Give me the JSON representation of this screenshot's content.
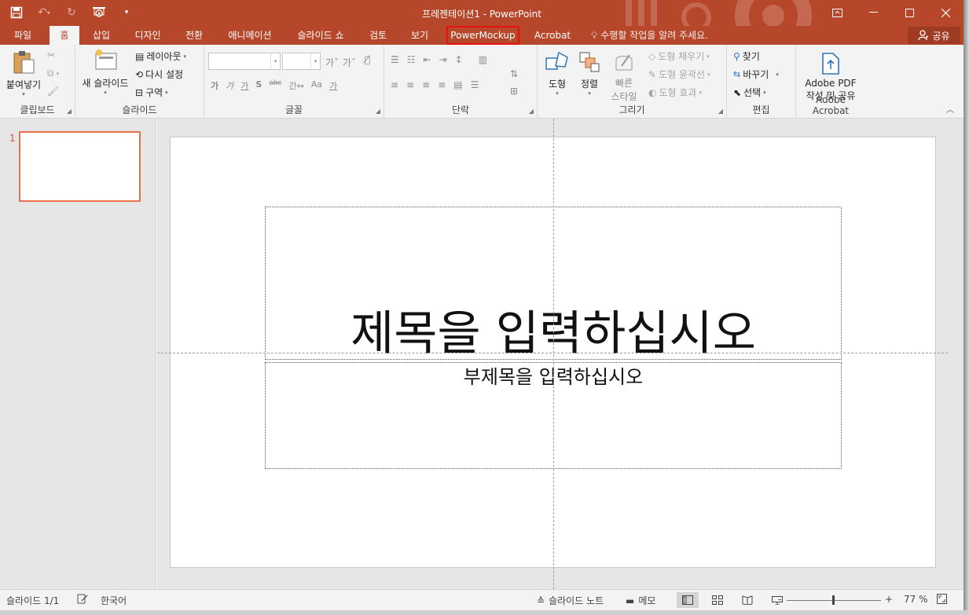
{
  "window": {
    "title": "프레젠테이션1 - PowerPoint",
    "minimize_icon": "minimize-icon",
    "restore_icon": "ribbon-display-icon",
    "maximize_icon": "maximize-icon",
    "close_icon": "close-icon"
  },
  "qat": [
    "save-icon",
    "undo-icon",
    "redo-icon",
    "present-from-start-icon",
    "customize-qat-icon"
  ],
  "tabs": {
    "file": "파일",
    "home": "홈",
    "insert": "삽입",
    "design": "디자인",
    "transitions": "전환",
    "animations": "애니메이션",
    "slideshow": "슬라이드 쇼",
    "review": "검토",
    "view": "보기",
    "powermockup": "PowerMockup",
    "acrobat": "Acrobat"
  },
  "tellme": "수행할 작업을 알려 주세요.",
  "share": "공유",
  "ribbon": {
    "clipboard": {
      "label": "클립보드",
      "paste": "붙여넣기"
    },
    "slides": {
      "label": "슬라이드",
      "new_slide": "새 슬라이드",
      "layout": "레이아웃",
      "reset": "다시 설정",
      "section": "구역"
    },
    "font": {
      "label": "글꼴",
      "font_name": "",
      "font_size": "",
      "row2": [
        "가",
        "가",
        "가",
        "S",
        "abc",
        "간↔",
        "Aa",
        "가"
      ]
    },
    "paragraph": {
      "label": "단락"
    },
    "drawing": {
      "label": "그리기",
      "shapes": "도형",
      "arrange": "정렬",
      "quick_styles_1": "빠른",
      "quick_styles_2": "스타일",
      "fill": "도형 채우기",
      "outline": "도형 윤곽선",
      "effects": "도형 효과"
    },
    "editing": {
      "label": "편집",
      "find": "찾기",
      "replace": "바꾸기",
      "select": "선택"
    },
    "acrobat": {
      "label": "Adobe Acrobat",
      "btn_line1": "Adobe PDF",
      "btn_line2": "작성 및 공유"
    }
  },
  "thumbnails": {
    "slide_number": "1"
  },
  "slide": {
    "title_placeholder": "제목을 입력하십시오",
    "subtitle_placeholder": "부제목을 입력하십시오"
  },
  "status": {
    "slide_counter": "슬라이드 1/1",
    "language": "한국어",
    "notes": "슬라이드 노트",
    "comments": "메모",
    "zoom_minus": "-",
    "zoom_plus": "+",
    "zoom": "77 %",
    "zoom_fraction": 0.48
  },
  "colors": {
    "accent": "#b7472a",
    "highlight_outline": "#e81010",
    "thumb_border": "#e8704f"
  }
}
